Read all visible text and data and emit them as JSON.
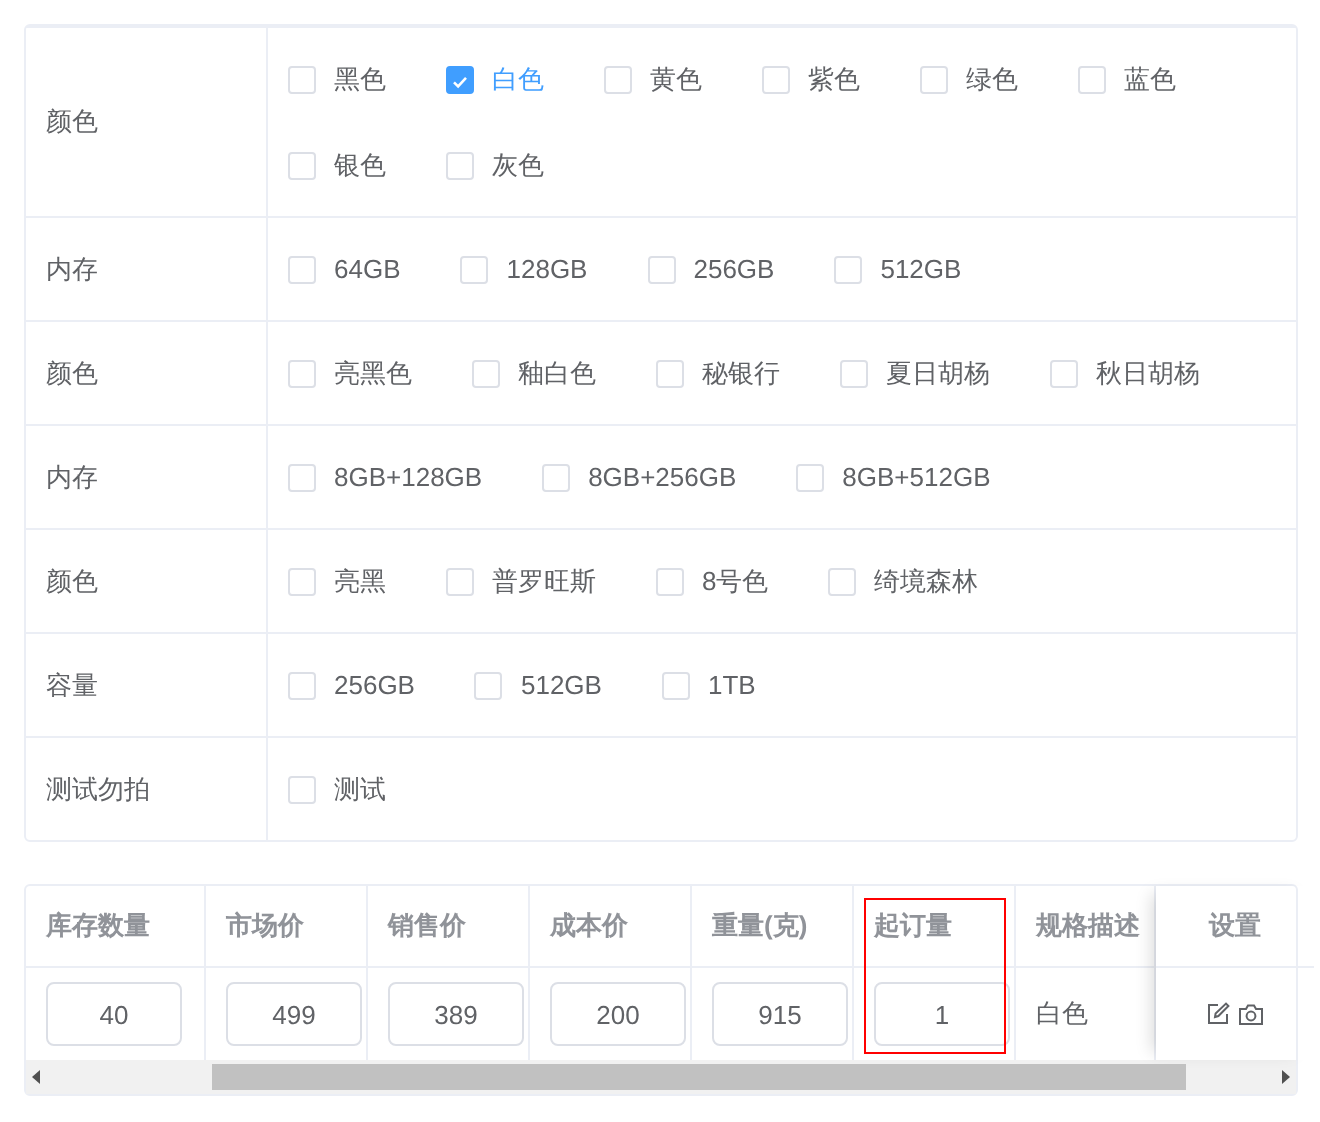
{
  "spec_groups": [
    {
      "label": "颜色",
      "options": [
        {
          "label": "黑色",
          "checked": false
        },
        {
          "label": "白色",
          "checked": true
        },
        {
          "label": "黄色",
          "checked": false
        },
        {
          "label": "紫色",
          "checked": false
        },
        {
          "label": "绿色",
          "checked": false
        },
        {
          "label": "蓝色",
          "checked": false
        },
        {
          "label": "银色",
          "checked": false
        },
        {
          "label": "灰色",
          "checked": false
        }
      ]
    },
    {
      "label": "内存",
      "options": [
        {
          "label": "64GB",
          "checked": false
        },
        {
          "label": "128GB",
          "checked": false
        },
        {
          "label": "256GB",
          "checked": false
        },
        {
          "label": "512GB",
          "checked": false
        }
      ]
    },
    {
      "label": "颜色",
      "options": [
        {
          "label": "亮黑色",
          "checked": false
        },
        {
          "label": "釉白色",
          "checked": false
        },
        {
          "label": "秘银行",
          "checked": false
        },
        {
          "label": "夏日胡杨",
          "checked": false
        },
        {
          "label": "秋日胡杨",
          "checked": false
        }
      ]
    },
    {
      "label": "内存",
      "options": [
        {
          "label": "8GB+128GB",
          "checked": false
        },
        {
          "label": "8GB+256GB",
          "checked": false
        },
        {
          "label": "8GB+512GB",
          "checked": false
        }
      ]
    },
    {
      "label": "颜色",
      "options": [
        {
          "label": "亮黑",
          "checked": false
        },
        {
          "label": "普罗旺斯",
          "checked": false
        },
        {
          "label": "8号色",
          "checked": false
        },
        {
          "label": "绮境森林",
          "checked": false
        }
      ]
    },
    {
      "label": "容量",
      "options": [
        {
          "label": "256GB",
          "checked": false
        },
        {
          "label": "512GB",
          "checked": false
        },
        {
          "label": "1TB",
          "checked": false
        }
      ]
    },
    {
      "label": "测试勿拍",
      "options": [
        {
          "label": "测试",
          "checked": false
        }
      ]
    }
  ],
  "sku_table": {
    "columns": [
      {
        "header": "库存数量",
        "kind": "input",
        "value": "40",
        "highlighted": false
      },
      {
        "header": "市场价",
        "kind": "input",
        "value": "499",
        "highlighted": false
      },
      {
        "header": "销售价",
        "kind": "input",
        "value": "389",
        "highlighted": false
      },
      {
        "header": "成本价",
        "kind": "input",
        "value": "200",
        "highlighted": false
      },
      {
        "header": "重量(克)",
        "kind": "input",
        "value": "915",
        "highlighted": false
      },
      {
        "header": "起订量",
        "kind": "input",
        "value": "1",
        "highlighted": true
      },
      {
        "header": "规格描述",
        "kind": "text",
        "value": "白色",
        "highlighted": false
      },
      {
        "header": "设置",
        "kind": "actions",
        "highlighted": false
      }
    ]
  }
}
